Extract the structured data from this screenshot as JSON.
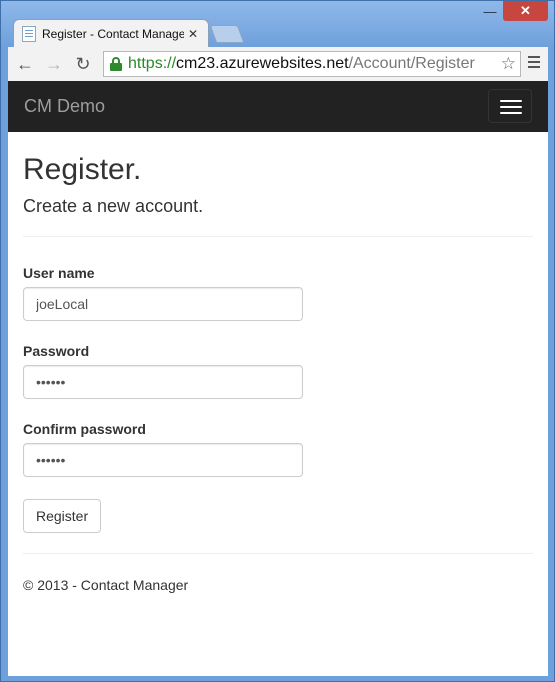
{
  "browser": {
    "tab_title": "Register - Contact Manage",
    "url_scheme": "https://",
    "url_host": "cm23.azurewebsites.net",
    "url_path": "/Account/Register",
    "icons": [
      "minimize-icon",
      "close-icon",
      "back-icon",
      "forward-icon",
      "reload-icon",
      "lock-icon",
      "star-icon",
      "menu-icon"
    ],
    "back_glyph": "←",
    "forward_glyph": "→",
    "reload_glyph": "↻",
    "star_glyph": "☆",
    "minimize_glyph": "—",
    "close_glyph": "✕",
    "tab_close_glyph": "✕"
  },
  "navbar": {
    "brand": "CM Demo"
  },
  "page": {
    "title": "Register.",
    "subtitle": "Create a new account."
  },
  "form": {
    "username_label": "User name",
    "username_value": "joeLocal",
    "password_label": "Password",
    "password_value": "••••••",
    "confirm_label": "Confirm password",
    "confirm_value": "••••••",
    "submit_label": "Register"
  },
  "footer": {
    "text": "© 2013 - Contact Manager"
  },
  "colors": {
    "navbar_bg": "#222222",
    "brand_text": "#9d9d9d",
    "url_scheme": "#2a8a2a",
    "window_frame": "#6ea0dc"
  }
}
